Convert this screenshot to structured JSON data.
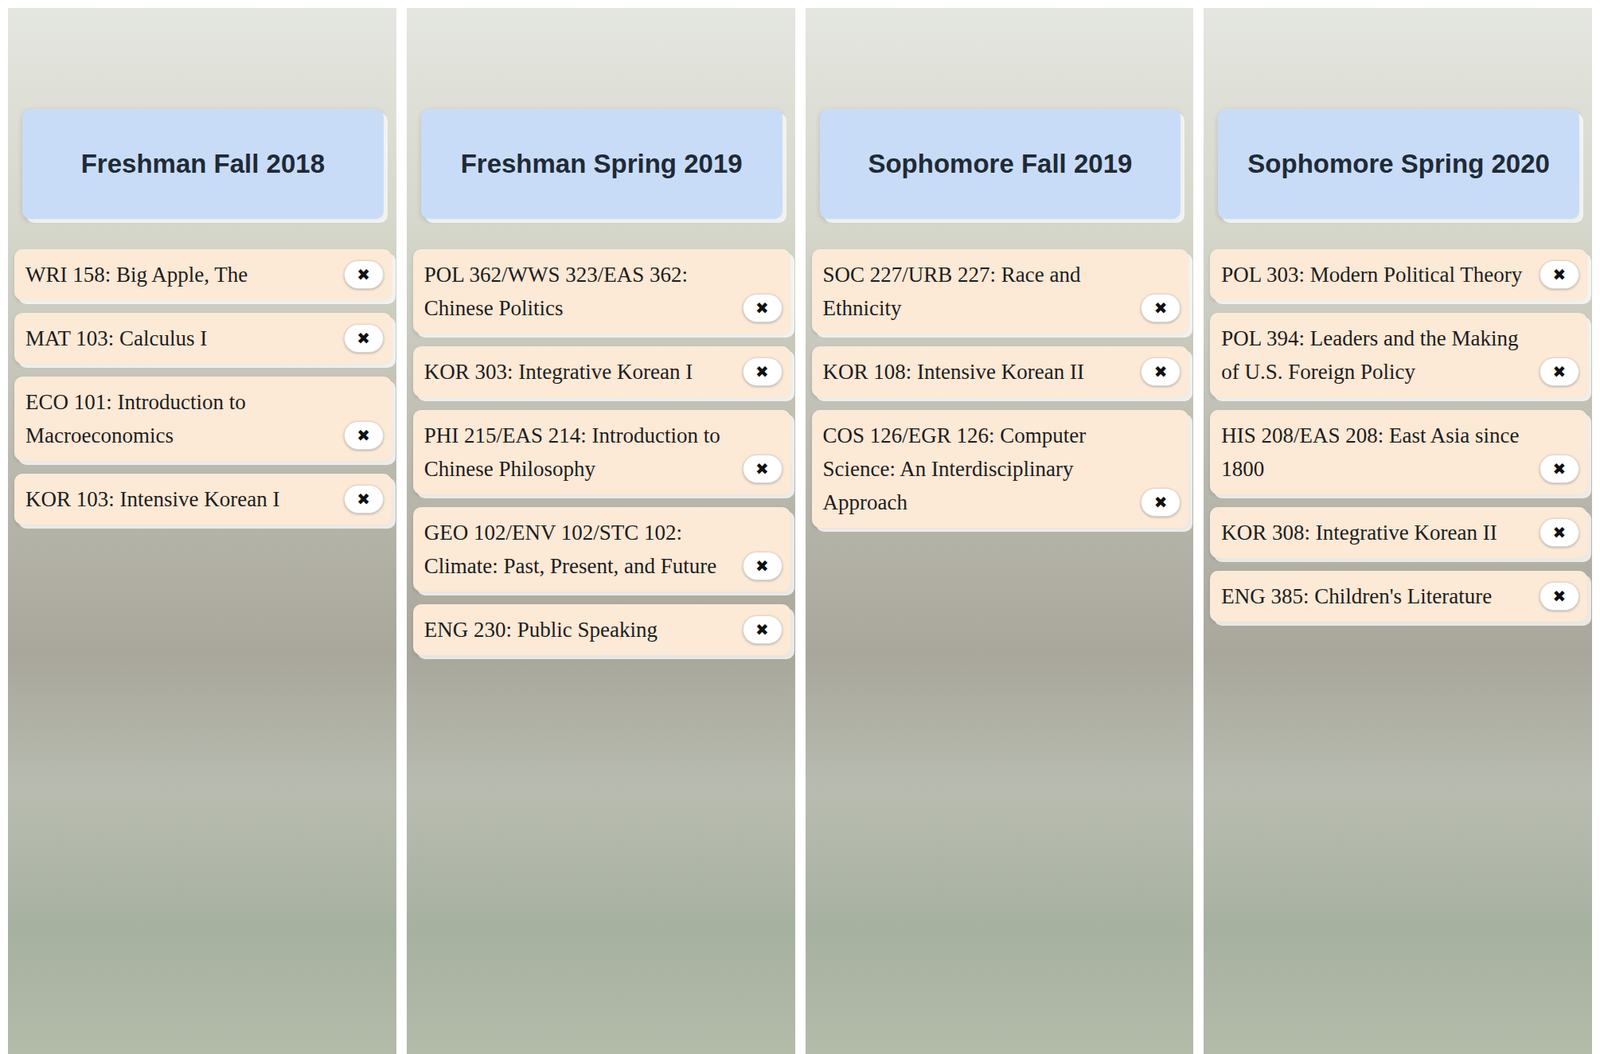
{
  "remove_glyph": "✖",
  "semesters": [
    {
      "title": "Freshman Fall 2018",
      "courses": [
        "WRI 158: Big Apple, The",
        "MAT 103: Calculus I",
        "ECO 101: Introduction to Macroeconomics",
        "KOR 103: Intensive Korean I"
      ]
    },
    {
      "title": "Freshman Spring 2019",
      "courses": [
        "POL 362/WWS 323/EAS 362: Chinese Politics",
        "KOR 303: Integrative Korean I",
        "PHI 215/EAS 214: Introduction to Chinese Philosophy",
        "GEO 102/ENV 102/STC 102: Climate: Past, Present, and Future",
        "ENG 230: Public Speaking"
      ]
    },
    {
      "title": "Sophomore Fall 2019",
      "courses": [
        "SOC 227/URB 227: Race and Ethnicity",
        "KOR 108: Intensive Korean II",
        "COS 126/EGR 126: Computer Science: An Interdisciplinary Approach"
      ]
    },
    {
      "title": "Sophomore Spring 2020",
      "courses": [
        "POL 303: Modern Political Theory",
        "POL 394: Leaders and the Making of U.S. Foreign Policy",
        "HIS 208/EAS 208: East Asia since 1800",
        "KOR 308: Integrative Korean II",
        "ENG 385: Children's Literature"
      ]
    }
  ]
}
